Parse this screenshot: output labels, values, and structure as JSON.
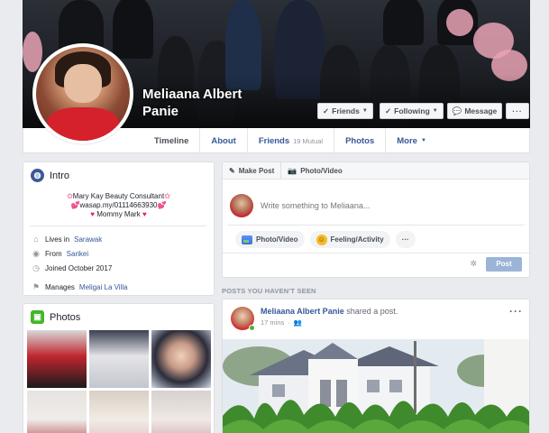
{
  "profile": {
    "name": "Meliaana Albert Panie"
  },
  "cover_buttons": {
    "friends": "Friends",
    "following": "Following",
    "message": "Message",
    "more": "···"
  },
  "nav": {
    "timeline": "Timeline",
    "about": "About",
    "friends": "Friends",
    "friends_mutual": "19 Mutual",
    "photos": "Photos",
    "more": "More"
  },
  "intro": {
    "title": "Intro",
    "bio_line1": "Mary Kay Beauty Consultant",
    "bio_line2": "wasap.my/01114663930",
    "bio_line3": "Mommy Mark",
    "lives_in_prefix": "Lives in",
    "lives_in": "Sarawak",
    "from_prefix": "From",
    "from": "Sarikei",
    "joined": "Joined October 2017",
    "manages_prefix": "Manages",
    "manages": "Meligai La Villa"
  },
  "photos_card": {
    "title": "Photos"
  },
  "composer": {
    "make_post": "Make Post",
    "photo_video_tab": "Photo/Video",
    "placeholder": "Write something to Meliaana...",
    "photo_video_btn": "Photo/Video",
    "feeling_btn": "Feeling/Activity",
    "more_btn": "···",
    "post_btn": "Post"
  },
  "section": {
    "posts_label": "POSTS YOU HAVEN'T SEEN"
  },
  "story": {
    "author": "Meliaana Albert Panie",
    "verb": "shared a post.",
    "time": "17 mins",
    "menu": "···"
  },
  "colors": {
    "fb_blue": "#365899",
    "bg": "#e9ebee",
    "post_disabled": "#9cb4d8",
    "online": "#42b72a"
  },
  "icons": {
    "intro": "globe-icon",
    "photos": "photos-icon",
    "lives": "home-icon",
    "from": "location-pin-icon",
    "joined": "clock-icon",
    "manages": "flag-icon",
    "audience": "friends-audience-icon",
    "settings": "gear-icon"
  }
}
